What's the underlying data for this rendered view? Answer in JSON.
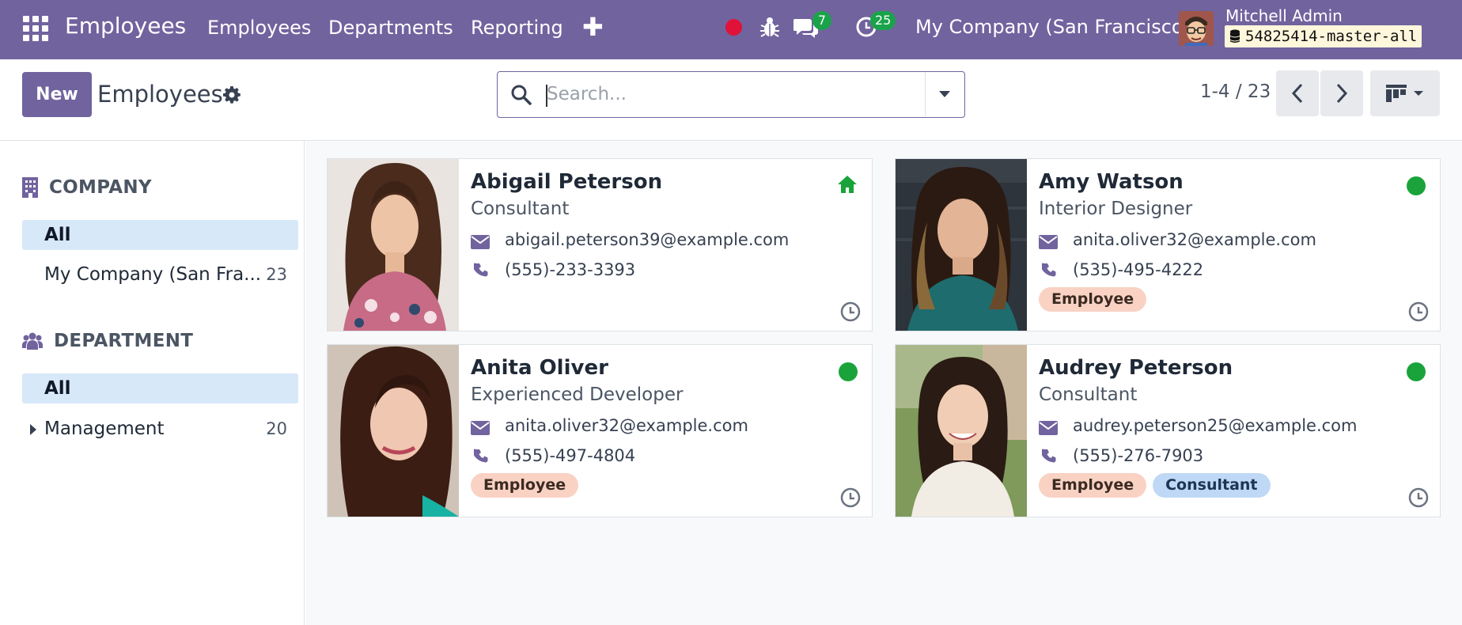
{
  "navbar": {
    "brand": "Employees",
    "menus": [
      "Employees",
      "Departments",
      "Reporting"
    ],
    "plus": "✚",
    "messages_count": "7",
    "activities_count": "25",
    "company": "My Company (San Francisco)",
    "user_name": "Mitchell Admin",
    "db_name": "54825414-master-all"
  },
  "control": {
    "new_label": "New",
    "title": "Employees",
    "search_placeholder": "Search...",
    "pager": "1-4 / 23"
  },
  "sidebar": {
    "company_header": "COMPANY",
    "company_items": [
      {
        "label": "All",
        "count": ""
      },
      {
        "label": "My Company (San Fra...",
        "count": "23"
      }
    ],
    "department_header": "DEPARTMENT",
    "department_items": [
      {
        "label": "All",
        "count": ""
      },
      {
        "label": "Management",
        "count": "20"
      }
    ]
  },
  "employees": [
    {
      "name": "Abigail Peterson",
      "job": "Consultant",
      "email": "abigail.peterson39@example.com",
      "phone": "(555)-233-3393",
      "tags": [],
      "status": "home"
    },
    {
      "name": "Amy Watson",
      "job": "Interior Designer",
      "email": "anita.oliver32@example.com",
      "phone": "(535)-495-4222",
      "tags": [
        "Employee"
      ],
      "status": "online"
    },
    {
      "name": "Anita Oliver",
      "job": "Experienced Developer",
      "email": "anita.oliver32@example.com",
      "phone": "(555)-497-4804",
      "tags": [
        "Employee"
      ],
      "status": "online"
    },
    {
      "name": "Audrey Peterson",
      "job": "Consultant",
      "email": "audrey.peterson25@example.com",
      "phone": "(555)-276-7903",
      "tags": [
        "Employee",
        "Consultant"
      ],
      "status": "online"
    }
  ],
  "colors": {
    "brand": "#71639e",
    "online": "#1aa33a",
    "tag_employee": "#f9d2c3",
    "tag_consultant": "#bfd8f5"
  }
}
